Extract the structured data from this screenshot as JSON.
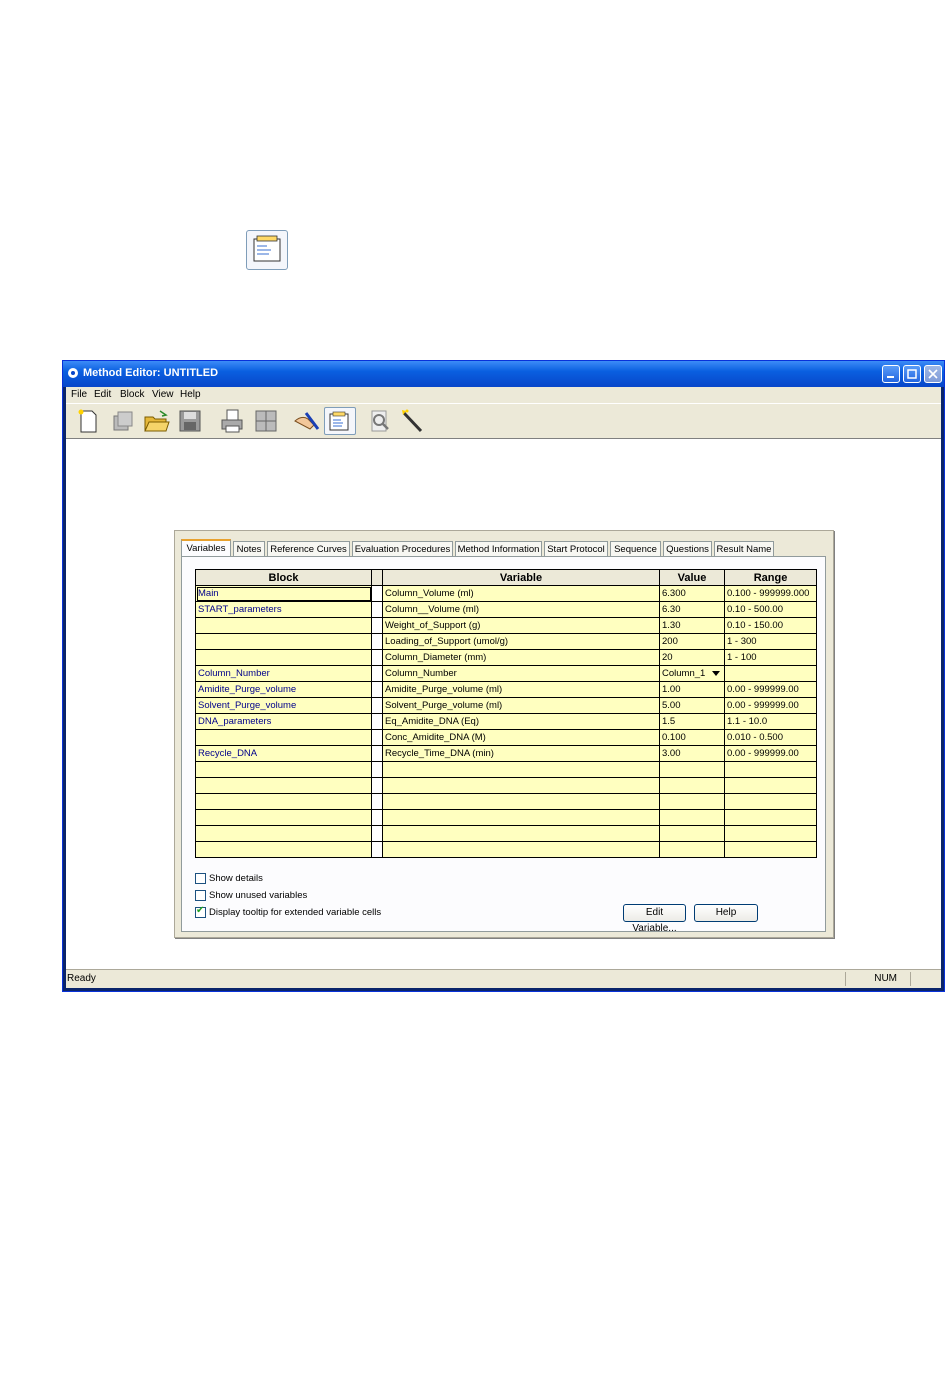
{
  "window": {
    "title": "Method Editor: UNTITLED"
  },
  "menu": [
    "File",
    "Edit",
    "Block",
    "View",
    "Help"
  ],
  "toolbar_icons": [
    "new-document-icon",
    "copy-icon",
    "open-folder-icon",
    "save-icon",
    "print-icon",
    "layout-icon",
    "pen-hand-icon",
    "variables-icon",
    "zoom-icon",
    "wand-icon"
  ],
  "tabs": [
    "Variables",
    "Notes",
    "Reference Curves",
    "Evaluation Procedures",
    "Method Information",
    "Start Protocol",
    "Sequence",
    "Questions",
    "Result Name"
  ],
  "grid": {
    "headers": {
      "block": "Block",
      "variable": "Variable",
      "value": "Value",
      "range": "Range"
    },
    "rows": [
      {
        "block": "Main",
        "variable": "Column_Volume (ml)",
        "value": "6.300",
        "range": "0.100 - 999999.000"
      },
      {
        "block": "START_parameters",
        "variable": "Column__Volume (ml)",
        "value": "6.30",
        "range": "0.10 - 500.00"
      },
      {
        "block": "",
        "variable": "Weight_of_Support (g)",
        "value": "1.30",
        "range": "0.10 - 150.00"
      },
      {
        "block": "",
        "variable": "Loading_of_Support (umol/g)",
        "value": "200",
        "range": "1 - 300"
      },
      {
        "block": "",
        "variable": "Column_Diameter (mm)",
        "value": "20",
        "range": "1 - 100"
      },
      {
        "block": "Column_Number",
        "variable": "Column_Number",
        "value": "Column_1",
        "range": ""
      },
      {
        "block": "Amidite_Purge_volume",
        "variable": "Amidite_Purge_volume (ml)",
        "value": "1.00",
        "range": "0.00 - 999999.00"
      },
      {
        "block": "Solvent_Purge_volume",
        "variable": "Solvent_Purge_volume (ml)",
        "value": "5.00",
        "range": "0.00 - 999999.00"
      },
      {
        "block": "DNA_parameters",
        "variable": "Eq_Amidite_DNA (Eq)",
        "value": "1.5",
        "range": "1.1 - 10.0"
      },
      {
        "block": "",
        "variable": "Conc_Amidite_DNA (M)",
        "value": "0.100",
        "range": "0.010 - 0.500"
      },
      {
        "block": "Recycle_DNA",
        "variable": "Recycle_Time_DNA (min)",
        "value": "3.00",
        "range": "0.00 - 999999.00"
      },
      {
        "block": "",
        "variable": "",
        "value": "",
        "range": ""
      },
      {
        "block": "",
        "variable": "",
        "value": "",
        "range": ""
      },
      {
        "block": "",
        "variable": "",
        "value": "",
        "range": ""
      },
      {
        "block": "",
        "variable": "",
        "value": "",
        "range": ""
      },
      {
        "block": "",
        "variable": "",
        "value": "",
        "range": ""
      },
      {
        "block": "",
        "variable": "",
        "value": "",
        "range": ""
      }
    ]
  },
  "options": {
    "show_details": {
      "label": "Show details",
      "checked": false
    },
    "show_unused": {
      "label": "Show unused variables",
      "checked": false
    },
    "tooltip": {
      "label": "Display tooltip for extended variable cells",
      "checked": true
    }
  },
  "buttons": {
    "edit_variable": "Edit Variable...",
    "help": "Help"
  },
  "status": {
    "text": "Ready",
    "num": "NUM"
  },
  "colors": {
    "titlebar": "#0a5fe0",
    "grid_cell": "#ffffc0",
    "block_text": "#00008b",
    "tab_highlight": "#e8a12e"
  }
}
